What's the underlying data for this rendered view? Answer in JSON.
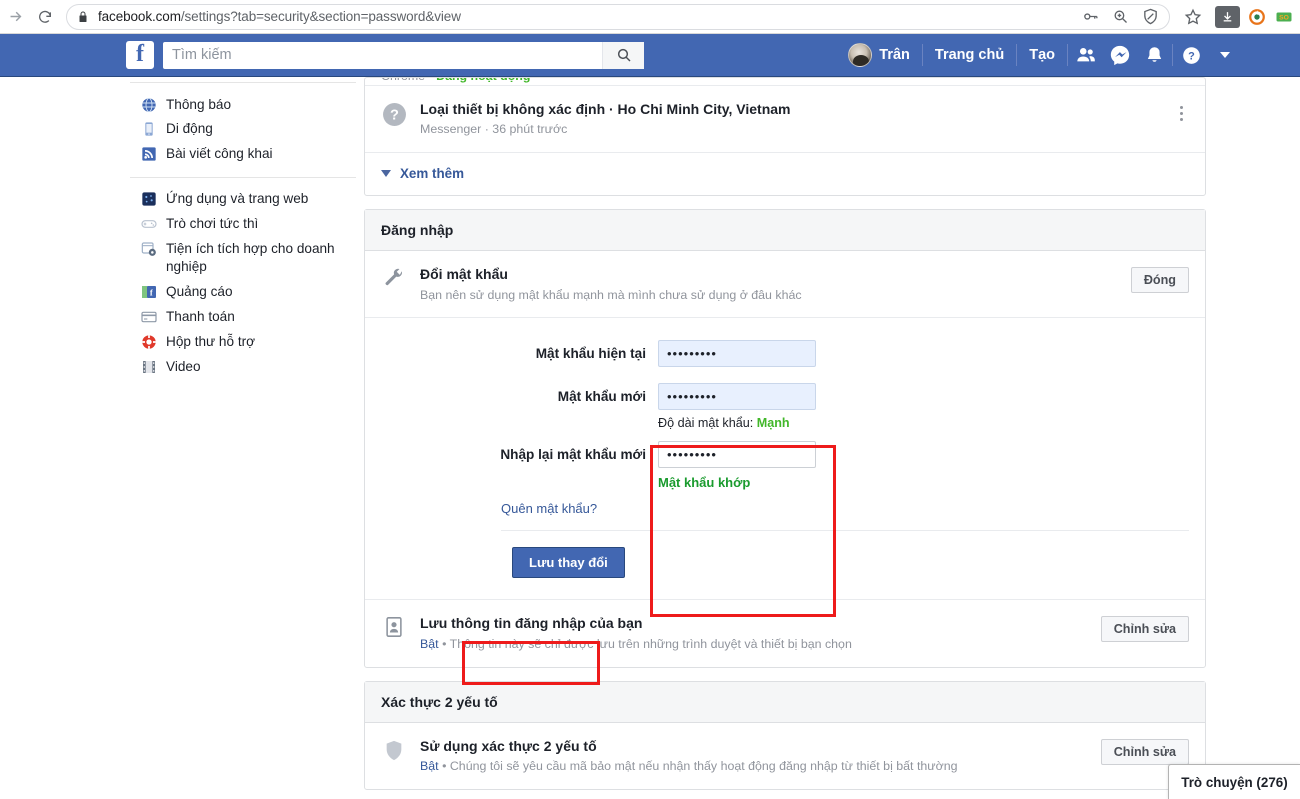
{
  "browser": {
    "url_prefix": "facebook.com",
    "url_suffix": "/settings?tab=security&section=password&view",
    "icons": {
      "forward": "forward-arrow-icon",
      "reload": "reload-icon",
      "lock": "lock-icon",
      "key": "key-icon",
      "zoom": "zoom-search-icon",
      "shield": "shield-block-icon",
      "bookmark": "star-icon",
      "download": "download-icon"
    }
  },
  "fb_nav": {
    "logo": "f",
    "search_placeholder": "Tìm kiếm",
    "search_value": "",
    "profile_name": "Trân",
    "home_label": "Trang chủ",
    "create_label": "Tạo"
  },
  "sidebar": {
    "groups": [
      {
        "items": [
          {
            "label": "Thông báo",
            "icon": "globe-icon"
          },
          {
            "label": "Di động",
            "icon": "mobile-icon"
          },
          {
            "label": "Bài viết công khai",
            "icon": "rss-icon"
          }
        ]
      },
      {
        "items": [
          {
            "label": "Ứng dụng và trang web",
            "icon": "apps-icon"
          },
          {
            "label": "Trò chơi tức thì",
            "icon": "gamepad-icon"
          },
          {
            "label": "Tiện ích tích hợp cho doanh nghiệp",
            "icon": "integration-gear-icon"
          },
          {
            "label": "Quảng cáo",
            "icon": "ads-icon"
          },
          {
            "label": "Thanh toán",
            "icon": "payment-card-icon"
          },
          {
            "label": "Hộp thư hỗ trợ",
            "icon": "lifebuoy-icon"
          },
          {
            "label": "Video",
            "icon": "video-film-icon"
          }
        ]
      }
    ]
  },
  "sessions_card": {
    "clipped_row": {
      "device": "Chrome",
      "separator": "·",
      "status": "Đang hoạt động"
    },
    "session": {
      "title": "Loại thiết bị không xác định · Ho Chi Minh City, Vietnam",
      "meta": "Messenger · 36 phút trước",
      "icon": "unknown-device-icon"
    },
    "see_more": "Xem thêm"
  },
  "login_card": {
    "header": "Đăng nhập",
    "change_password": {
      "icon": "wrench-icon",
      "title": "Đổi mật khẩu",
      "subtitle": "Bạn nên sử dụng mật khẩu mạnh mà mình chưa sử dụng ở đâu khác",
      "close_label": "Đóng"
    },
    "form": {
      "current_label": "Mật khẩu hiện tại",
      "current_value": "•••••••••",
      "new_label": "Mật khẩu mới",
      "new_value": "•••••••••",
      "strength_prefix": "Độ dài mật khẩu:",
      "strength_value": "Mạnh",
      "confirm_label": "Nhập lại mật khẩu mới",
      "confirm_value": "•••••••••",
      "match_text": "Mật khẩu khớp",
      "forgot_link": "Quên mật khẩu?",
      "save_label": "Lưu thay đổi"
    },
    "save_login_info": {
      "icon": "id-card-icon",
      "title": "Lưu thông tin đăng nhập của bạn",
      "state": "Bật",
      "separator": "•",
      "subtitle": "Thông tin này sẽ chỉ được lưu trên những trình duyệt và thiết bị bạn chọn",
      "edit_label": "Chỉnh sửa"
    }
  },
  "twofa_card": {
    "header": "Xác thực 2 yếu tố",
    "row": {
      "icon": "shield-icon",
      "title": "Sử dụng xác thực 2 yếu tố",
      "state": "Bật",
      "separator": "•",
      "subtitle": "Chúng tôi sẽ yêu cầu mã bảo mật nếu nhận thấy hoạt động đăng nhập từ thiết bị bất thường",
      "edit_label": "Chỉnh sửa"
    }
  },
  "chat": {
    "label": "Trò chuyện (276)"
  },
  "colors": {
    "fb_blue": "#4267b2",
    "link_blue": "#365899",
    "green": "#42b72a",
    "annotation_red": "#ee1b1b",
    "autofill_blue": "#e8f0fe"
  }
}
